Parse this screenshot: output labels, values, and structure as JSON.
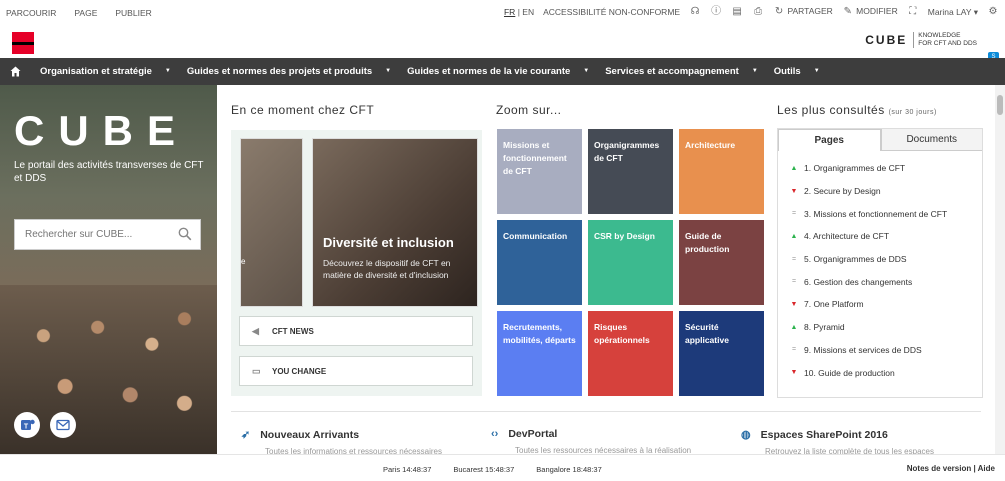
{
  "topbar": {
    "left": [
      "PARCOURIR",
      "PAGE",
      "PUBLIER"
    ],
    "lang_fr": "FR",
    "lang_sep": "|",
    "lang_en": "EN",
    "accessibility": "ACCESSIBILITÉ NON-CONFORME",
    "share": "PARTAGER",
    "edit": "MODIFIER",
    "user": "Marina LAY"
  },
  "header": {
    "brand": "CUBE",
    "tag_line1": "KNOWLEDGE",
    "tag_line2": "FOR CFT AND DDS",
    "badge": "S"
  },
  "nav": [
    "Organisation et stratégie",
    "Guides et normes des projets et produits",
    "Guides et normes de la vie courante",
    "Services et accompagnement",
    "Outils"
  ],
  "hero": {
    "title": "CUBE",
    "subtitle": "Le portail des activités transverses de CFT et DDS",
    "search_placeholder": "Rechercher sur CUBE..."
  },
  "news": {
    "title": "En ce moment chez CFT",
    "card_title": "Diversité et inclusion",
    "card_desc": "Découvrez le dispositif de CFT en matière de diversité et d'inclusion",
    "card_small_text": "e",
    "btn1": "CFT NEWS",
    "btn2": "YOU CHANGE"
  },
  "zoom": {
    "title": "Zoom sur...",
    "tiles": [
      {
        "label": "Missions et fonctionnement de CFT",
        "color": "#a8adc0"
      },
      {
        "label": "Organigrammes de CFT",
        "color": "#454b55"
      },
      {
        "label": "Architecture",
        "color": "#e8904e"
      },
      {
        "label": "Communication",
        "color": "#2f6299"
      },
      {
        "label": "CSR by Design",
        "color": "#3cba8f"
      },
      {
        "label": "Guide de production",
        "color": "#7b4242"
      },
      {
        "label": "Recrutements, mobilités, départs",
        "color": "#5b7ef2"
      },
      {
        "label": "Risques opérationnels",
        "color": "#d6413c"
      },
      {
        "label": "Sécurité applicative",
        "color": "#1d3a7a"
      }
    ]
  },
  "most_viewed": {
    "title": "Les plus consultés",
    "subtitle": "(sur 30 jours)",
    "tab_pages": "Pages",
    "tab_docs": "Documents",
    "items": [
      {
        "label": "1. Organigrammes de CFT",
        "trend": "up"
      },
      {
        "label": "2. Secure by Design",
        "trend": "down"
      },
      {
        "label": "3. Missions et fonctionnement de CFT",
        "trend": "eq"
      },
      {
        "label": "4. Architecture de CFT",
        "trend": "up"
      },
      {
        "label": "5. Organigrammes de DDS",
        "trend": "eq"
      },
      {
        "label": "6. Gestion des changements",
        "trend": "eq"
      },
      {
        "label": "7. One Platform",
        "trend": "down"
      },
      {
        "label": "8. Pyramid",
        "trend": "up"
      },
      {
        "label": "9. Missions et services de DDS",
        "trend": "eq"
      },
      {
        "label": "10. Guide de production",
        "trend": "down"
      }
    ]
  },
  "bottom": [
    {
      "title": "Nouveaux Arrivants",
      "desc": "Toutes les informations et ressources nécessaires"
    },
    {
      "title": "DevPortal",
      "desc": "Toutes les ressources nécessaires à la réalisation"
    },
    {
      "title": "Espaces SharePoint 2016",
      "desc": "Retrouvez la liste complète de tous les espaces"
    }
  ],
  "footer": {
    "clock1": "Paris 14:48:37",
    "clock2": "Bucarest 15:48:37",
    "clock3": "Bangalore 18:48:37",
    "notes": "Notes de version",
    "sep": "|",
    "help": "Aide"
  }
}
